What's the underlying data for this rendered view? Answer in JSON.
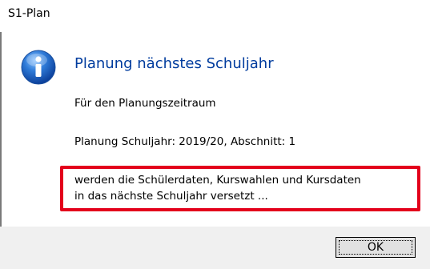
{
  "window": {
    "title": "S1-Plan"
  },
  "dialog": {
    "icon": "info-icon",
    "heading": "Planung nächstes Schuljahr",
    "line_1": "Für den Planungszeitraum",
    "line_2": "Planung Schuljahr: 2019/20, Abschnitt: 1",
    "highlighted_line_1": "werden die Schülerdaten, Kurswahlen und Kursdaten",
    "highlighted_line_2": "in das nächste Schuljahr versetzt ...",
    "highlight_color": "#e3001b",
    "heading_color": "#003c9e"
  },
  "buttons": {
    "ok_label": "OK"
  }
}
